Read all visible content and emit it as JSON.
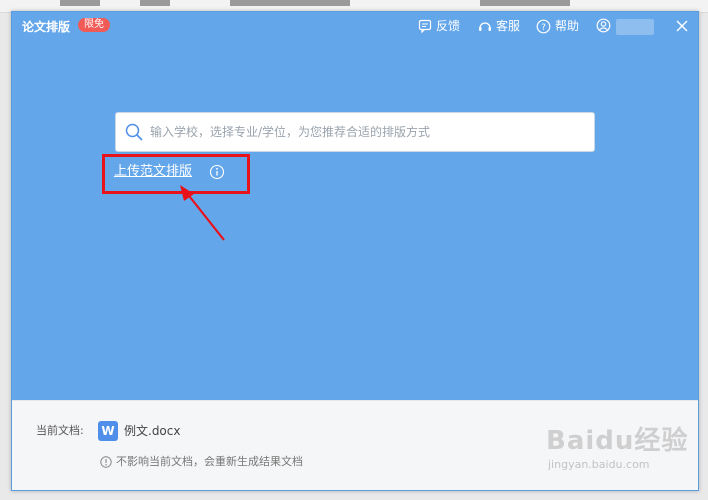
{
  "app": {
    "title": "论文排版",
    "badge": "限免"
  },
  "titlebar": {
    "feedback_label": "反馈",
    "service_label": "客服",
    "help_label": "帮助"
  },
  "search": {
    "placeholder": "输入学校，选择专业/学位，为您推荐合适的排版方式",
    "value": ""
  },
  "upload": {
    "label": "上传范文排版"
  },
  "footer": {
    "current_doc_label": "当前文档:",
    "doc_icon_letter": "W",
    "doc_name": "例文.docx",
    "notice": "不影响当前文档，会重新生成结果文档"
  },
  "watermark": {
    "main": "Baidu经验",
    "sub": "jingyan.baidu.com"
  },
  "colors": {
    "window_bg": "#64a6ea",
    "badge_bg": "#f05a57",
    "annotation_red": "#e8121b",
    "doc_icon_bg": "#4f8ee9",
    "footer_bg": "#f5f6f8"
  },
  "icons": {
    "feedback": "message-icon",
    "service": "headset-icon",
    "help": "help-icon",
    "user": "user-icon",
    "close": "close-icon",
    "search": "search-icon",
    "info": "info-icon"
  }
}
